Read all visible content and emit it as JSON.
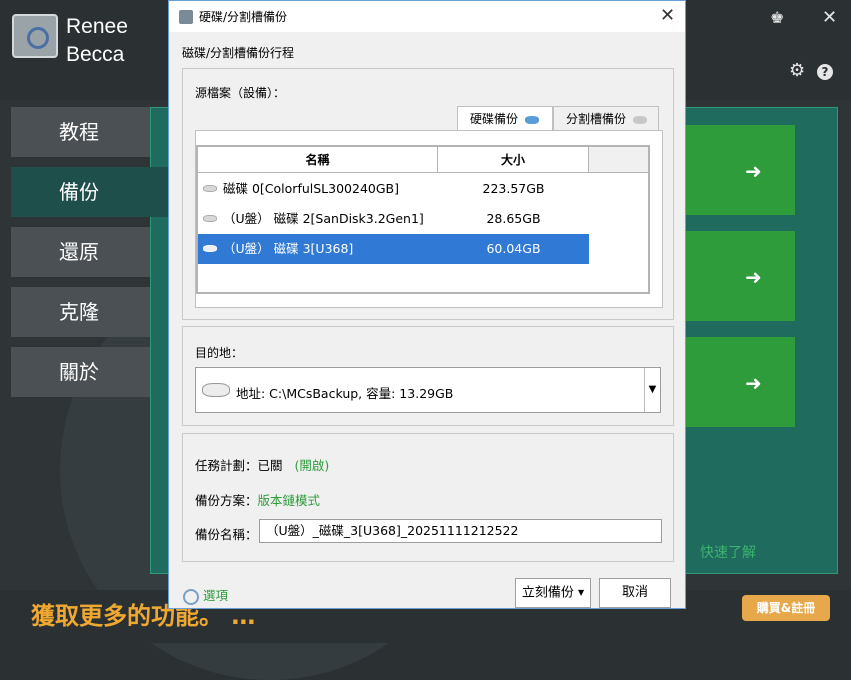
{
  "app": {
    "brand_line1": "Renee",
    "brand_line2": "Becca",
    "sidebar": [
      {
        "label": "教程"
      },
      {
        "label": "備份"
      },
      {
        "label": "還原"
      },
      {
        "label": "克隆"
      },
      {
        "label": "關於"
      }
    ],
    "learn_more": "快速了解",
    "promo_text": "獲取更多的功能。 …",
    "buy_button": "購買&註冊",
    "colors": {
      "accent_green": "#2e9c3b",
      "panel_teal": "#1f6b5d",
      "promo_orange": "#f0a830"
    }
  },
  "dialog": {
    "title": "硬碟/分割槽備份",
    "section_label": "磁碟/分割槽備份行程",
    "source": {
      "label": "源檔案（設備）：",
      "tabs": [
        "硬碟備份",
        "分割槽備份"
      ],
      "columns": [
        "名稱",
        "大小"
      ],
      "rows": [
        {
          "name": "磁碟 0[ColorfulSL300240GB]",
          "size": "223.57GB"
        },
        {
          "name": "（U盤） 磁碟 2[SanDisk3.2Gen1]",
          "size": "28.65GB"
        },
        {
          "name": "（U盤） 磁碟 3[U368]",
          "size": "60.04GB"
        }
      ]
    },
    "destination": {
      "label": "目的地：",
      "value": "地址: C:\\MCsBackup, 容量: 13.29GB"
    },
    "options": {
      "schedule_label": "任務計劃：已關",
      "schedule_link": "(開啟)",
      "scheme_label": "備份方案：",
      "scheme_value": "版本鏈模式",
      "name_label": "備份名稱：",
      "name_value": "（U盤）_磁碟_3[U368]_20251111212522"
    },
    "options_link": "選項",
    "backup_now": "立刻備份",
    "cancel": "取消"
  }
}
